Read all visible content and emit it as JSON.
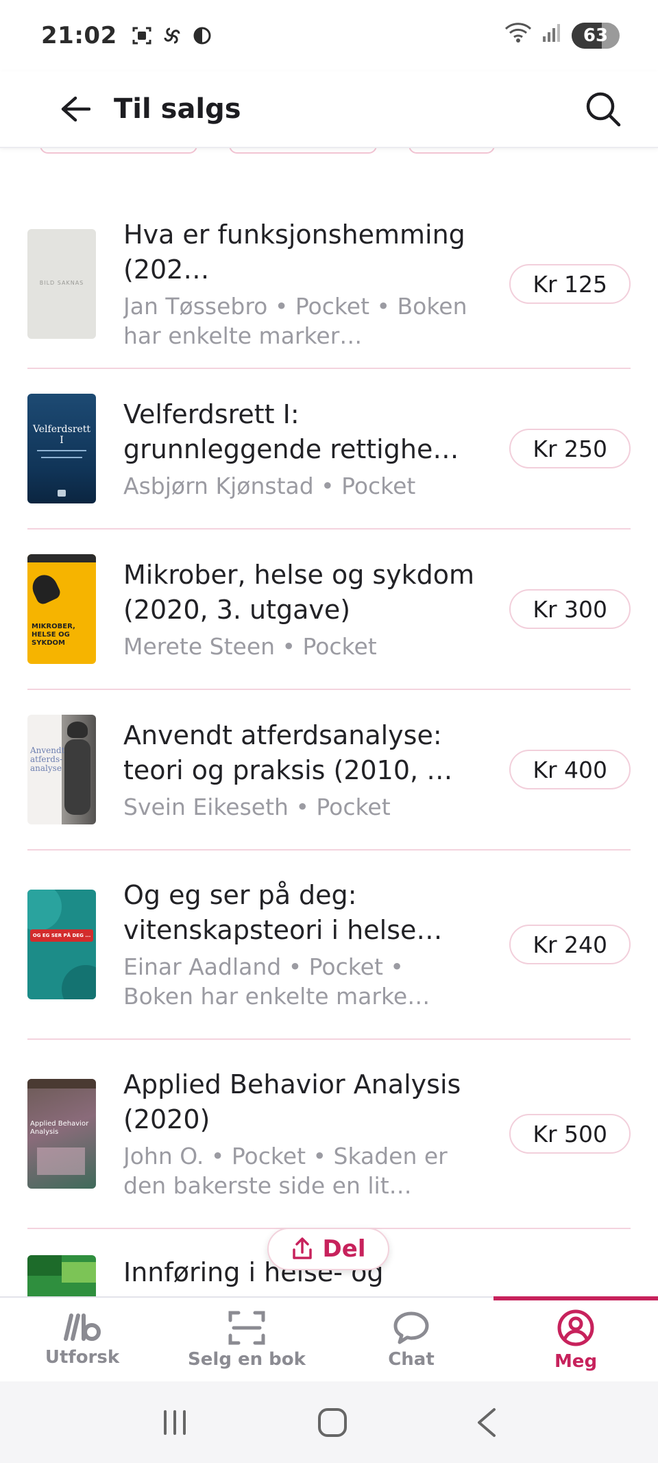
{
  "status_bar": {
    "time": "21:02",
    "battery": "63",
    "battery_level": 0.63
  },
  "app_bar": {
    "title": "Til salgs"
  },
  "listings": [
    {
      "title": "Hva er funksjonshemming (202…",
      "meta": "Jan Tøssebro • Pocket • Boken har enkelte marker…",
      "price": "Kr 125",
      "cover_placeholder": "BILD SAKNAS"
    },
    {
      "title": "Velferdsrett I: grunnleggende rettighe…",
      "meta": "Asbjørn Kjønstad • Pocket",
      "price": "Kr 250",
      "cover_text": "Velferdsrett I"
    },
    {
      "title": "Mikrober, helse og sykdom (2020, 3. utgave)",
      "meta": "Merete Steen • Pocket",
      "price": "Kr 300",
      "cover_text": "MIKROBER, HELSE OG SYKDOM"
    },
    {
      "title": "Anvendt atferdsanalyse: teori og praksis (2010, …",
      "meta": "Svein Eikeseth • Pocket",
      "price": "Kr 400",
      "cover_text": "Anvendt atferds-analyse"
    },
    {
      "title": "Og eg ser på deg: vitenskapsteori i helse…",
      "meta": "Einar Aadland • Pocket • Boken har enkelte marke…",
      "price": "Kr 240",
      "cover_text": "OG EG SER PÅ DEG ..."
    },
    {
      "title": "Applied Behavior Analysis (2020)",
      "meta": "John O. • Pocket • Skaden er den bakerste side en lit…",
      "price": "Kr 500",
      "cover_text": "Applied Behavior Analysis"
    },
    {
      "title": "Innføring i helse- og",
      "meta": "",
      "price": ""
    }
  ],
  "share": {
    "label": "Del"
  },
  "bottom_nav": [
    {
      "label": "Utforsk",
      "icon": "logo-icon"
    },
    {
      "label": "Selg en bok",
      "icon": "scan-icon"
    },
    {
      "label": "Chat",
      "icon": "chat-icon"
    },
    {
      "label": "Meg",
      "icon": "profile-icon",
      "active": true
    }
  ],
  "colors": {
    "accent": "#c7225c",
    "divider": "#f4d3de",
    "muted_text": "#9b9ba2"
  }
}
